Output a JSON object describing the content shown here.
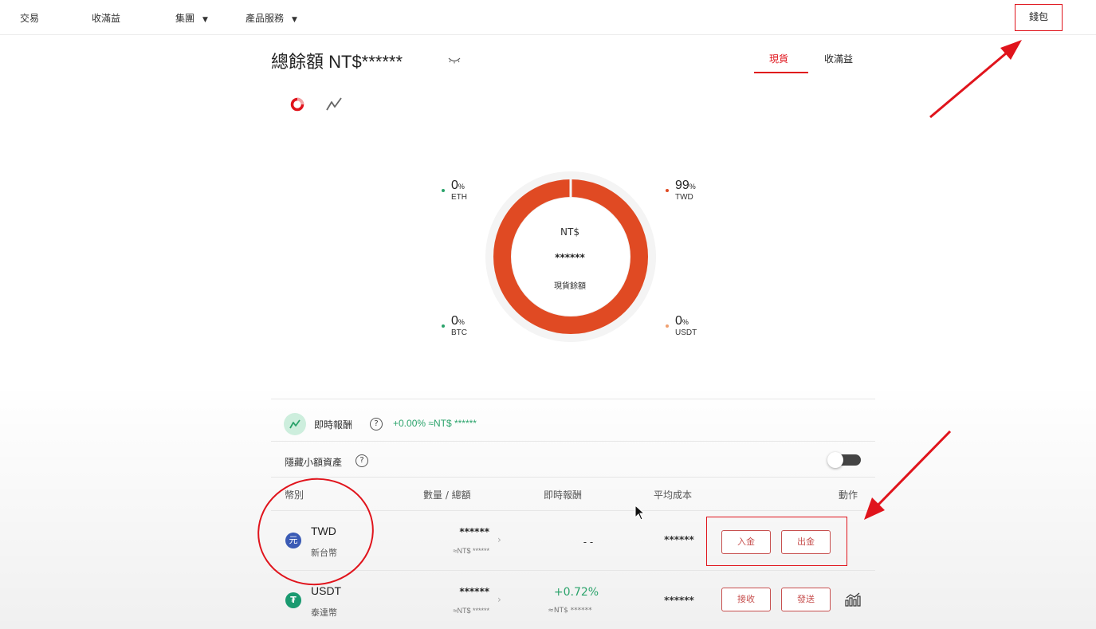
{
  "nav": {
    "trade": "交易",
    "earn": "收滿益",
    "group": "集團",
    "products": "產品服務",
    "wallet": "錢包"
  },
  "header": {
    "title": "總餘額 NT$******",
    "tabs": [
      "現貨",
      "收滿益"
    ],
    "active_tab": "現貨"
  },
  "donut": {
    "center_currency": "NT$",
    "center_value": "******",
    "center_label": "現貨餘額",
    "legend": [
      {
        "pct": "0",
        "unit": "%",
        "label": "ETH",
        "color": "#2ba36b"
      },
      {
        "pct": "99",
        "unit": "%",
        "label": "TWD",
        "color": "#e04a23"
      },
      {
        "pct": "0",
        "unit": "%",
        "label": "BTC",
        "color": "#2ba36b"
      },
      {
        "pct": "0",
        "unit": "%",
        "label": "USDT",
        "color": "#f0a070"
      }
    ],
    "twd_share": 99,
    "ring_color": "#e04a23"
  },
  "returns": {
    "label": "即時報酬",
    "value": "+0.00% ≈NT$ ******"
  },
  "hide_small": {
    "label": "隱藏小額資產",
    "enabled": false
  },
  "table": {
    "headers": [
      "幣別",
      "數量 / 總額",
      "即時報酬",
      "平均成本",
      "動作"
    ],
    "rows": [
      {
        "code": "TWD",
        "name": "新台幣",
        "icon_glyph": "元",
        "icon_color": "#3b5bb5",
        "amount": "******",
        "amount_sub": "≈NT$ ******",
        "return": "- -",
        "return_sub": "",
        "avg_cost": "******",
        "actions": [
          "入金",
          "出金"
        ]
      },
      {
        "code": "USDT",
        "name": "泰達幣",
        "icon_glyph": "₮",
        "icon_color": "#1a9a70",
        "amount": "******",
        "amount_sub": "≈NT$ ******",
        "return": "+0.72%",
        "return_sub": "≈NT$ ******",
        "avg_cost": "******",
        "actions": [
          "接收",
          "發送"
        ]
      }
    ]
  },
  "colors": {
    "accent_red": "#e0141c",
    "positive_green": "#2ba36b",
    "button_red": "#c7504f"
  }
}
